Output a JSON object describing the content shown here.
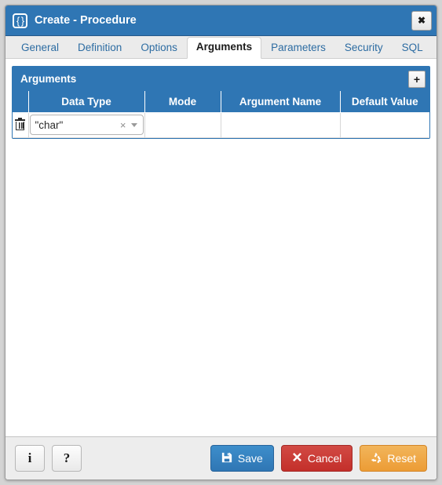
{
  "window": {
    "title": "Create - Procedure",
    "icon": "curly-braces-icon",
    "icon_glyph": "{ }",
    "close_label": "✖"
  },
  "tabs": [
    {
      "label": "General",
      "active": false
    },
    {
      "label": "Definition",
      "active": false
    },
    {
      "label": "Options",
      "active": false
    },
    {
      "label": "Arguments",
      "active": true
    },
    {
      "label": "Parameters",
      "active": false
    },
    {
      "label": "Security",
      "active": false
    },
    {
      "label": "SQL",
      "active": false
    }
  ],
  "panel": {
    "title": "Arguments",
    "add_button_label": "+",
    "add_button_icon": "plus-icon"
  },
  "grid": {
    "columns": [
      "",
      "Data Type",
      "Mode",
      "Argument Name",
      "Default Value"
    ],
    "rows": [
      {
        "delete_icon": "trash-icon",
        "data_type": "\"char\"",
        "data_type_clear": "×",
        "mode": "",
        "argument_name": "",
        "default_value": ""
      }
    ]
  },
  "footer": {
    "info_label": "i",
    "help_label": "?",
    "save_label": "Save",
    "cancel_label": "Cancel",
    "reset_label": "Reset"
  },
  "colors": {
    "accent_blue": "#2f76b4",
    "save_blue": "#2f76b4",
    "cancel_red": "#c32f2a",
    "reset_orange": "#ec9c35",
    "window_bg": "#d4d4d4"
  }
}
